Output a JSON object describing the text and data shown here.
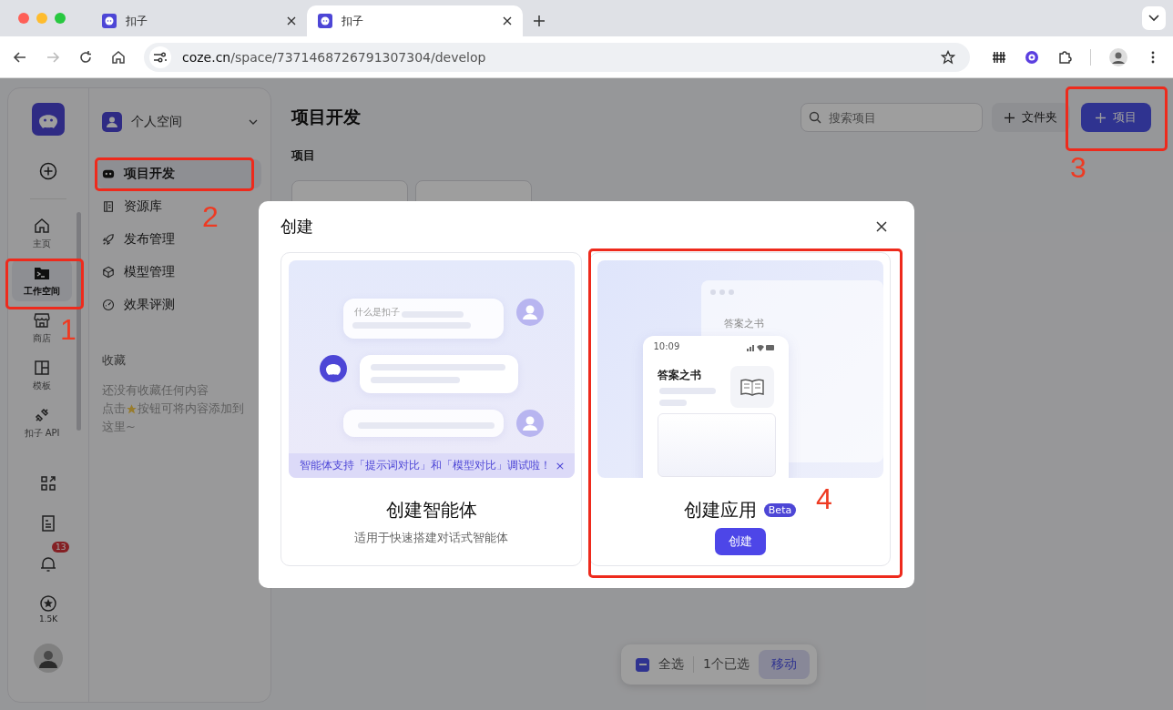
{
  "browser": {
    "tabs": [
      {
        "title": "扣子",
        "selected": false
      },
      {
        "title": "扣子",
        "selected": true
      }
    ],
    "url_host": "coze.cn",
    "url_path": "/space/7371468726791307304/develop"
  },
  "rail": {
    "items": [
      {
        "kind": "home",
        "label": "主页",
        "selected": false
      },
      {
        "kind": "workspace",
        "label": "工作空间",
        "selected": true
      },
      {
        "kind": "store",
        "label": "商店",
        "selected": false
      },
      {
        "kind": "template",
        "label": "模板",
        "selected": false
      },
      {
        "kind": "api",
        "label": "扣子 API",
        "selected": false
      }
    ],
    "bottom": [
      {
        "kind": "apps"
      },
      {
        "kind": "doc"
      },
      {
        "kind": "bell",
        "badge": "13"
      },
      {
        "kind": "star",
        "label": "1.5K"
      }
    ]
  },
  "space_nav": {
    "space": "个人空间",
    "items": [
      {
        "kind": "develop",
        "label": "项目开发",
        "selected": true
      },
      {
        "kind": "library",
        "label": "资源库",
        "selected": false
      },
      {
        "kind": "publish",
        "label": "发布管理",
        "selected": false
      },
      {
        "kind": "model",
        "label": "模型管理",
        "selected": false
      },
      {
        "kind": "eval",
        "label": "效果评测",
        "selected": false
      }
    ],
    "favorites_title": "收藏",
    "favorites_empty": "还没有收藏任何内容",
    "hint_before": "点击",
    "hint_after": "按钮可将内容添加到",
    "hint_line2": "这里~"
  },
  "main": {
    "title": "项目开发",
    "search_placeholder": "搜索项目",
    "folder_button": "文件夹",
    "new_button": "项目",
    "section": "项目"
  },
  "modal": {
    "title": "创建",
    "cards": [
      {
        "kind": "agent",
        "title": "创建智能体",
        "subtitle": "适用于快速搭建对话式智能体",
        "banner": "智能体支持「提示词对比」和「模型对比」调试啦！",
        "banner_close": "×",
        "chat_caption": "什么是扣子"
      },
      {
        "kind": "app",
        "title": "创建应用",
        "badge": "Beta",
        "button": "创建",
        "phone_time": "10:09",
        "app_title": "答案之书",
        "back_title": "答案之书"
      }
    ]
  },
  "selection_bar": {
    "partial": true,
    "select_all": "全选",
    "count": "1个已选",
    "move": "移动"
  },
  "annotations": [
    {
      "label": "1"
    },
    {
      "label": "2"
    },
    {
      "label": "3"
    },
    {
      "label": "4"
    }
  ]
}
